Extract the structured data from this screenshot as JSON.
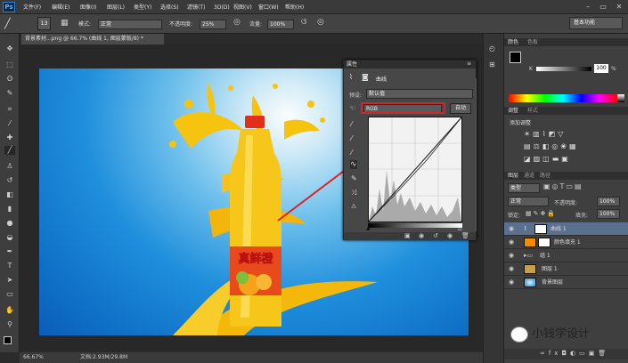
{
  "app": {
    "logo": "Ps",
    "menus": [
      "文件(F)",
      "编辑(E)",
      "图像(I)",
      "图层(L)",
      "类型(Y)",
      "选择(S)",
      "滤镜(T)",
      "3D(D)",
      "视图(V)",
      "窗口(W)",
      "帮助(H)"
    ],
    "window_buttons": [
      "–",
      "▭",
      "✕"
    ]
  },
  "options": {
    "brush_size": "13",
    "mode_label": "模式:",
    "mode_value": "正常",
    "opacity_label": "不透明度:",
    "opacity_value": "25%",
    "flow_label": "流量:",
    "flow_value": "100%",
    "workspace": "基本功能"
  },
  "document": {
    "tab": "背景素材...png @ 66.7% (曲线 1, 图层蒙版/8) *",
    "status_zoom": "66.67%",
    "status_doc": "文档:2.93M/29.8M",
    "label_cn": "真鲜橙"
  },
  "curves": {
    "panel_title": "属性",
    "title": "曲线",
    "preset_label": "预设:",
    "preset_value": "默认值",
    "channel": "RGB",
    "auto_button": "自动"
  },
  "color_panel": {
    "tabs": [
      "颜色",
      "色板"
    ],
    "k_label": "K",
    "k_value": "100",
    "pct": "%"
  },
  "adjust_panel": {
    "tabs": [
      "调整",
      "样式"
    ],
    "title": "添加调整"
  },
  "layers_panel": {
    "tabs": [
      "图层",
      "通道",
      "路径"
    ],
    "kind": "类型",
    "blend": "正常",
    "opacity_label": "不透明度:",
    "opacity_value": "100%",
    "lock_label": "锁定:",
    "fill_label": "填充:",
    "fill_value": "100%",
    "layers": [
      {
        "name": "曲线 1",
        "active": true
      },
      {
        "name": "颜色填充 1",
        "active": false
      },
      {
        "name": "组 1",
        "active": false
      },
      {
        "name": "图层 1",
        "active": false
      },
      {
        "name": "背景图层",
        "active": false
      }
    ]
  },
  "watermark": "小钱学设计"
}
